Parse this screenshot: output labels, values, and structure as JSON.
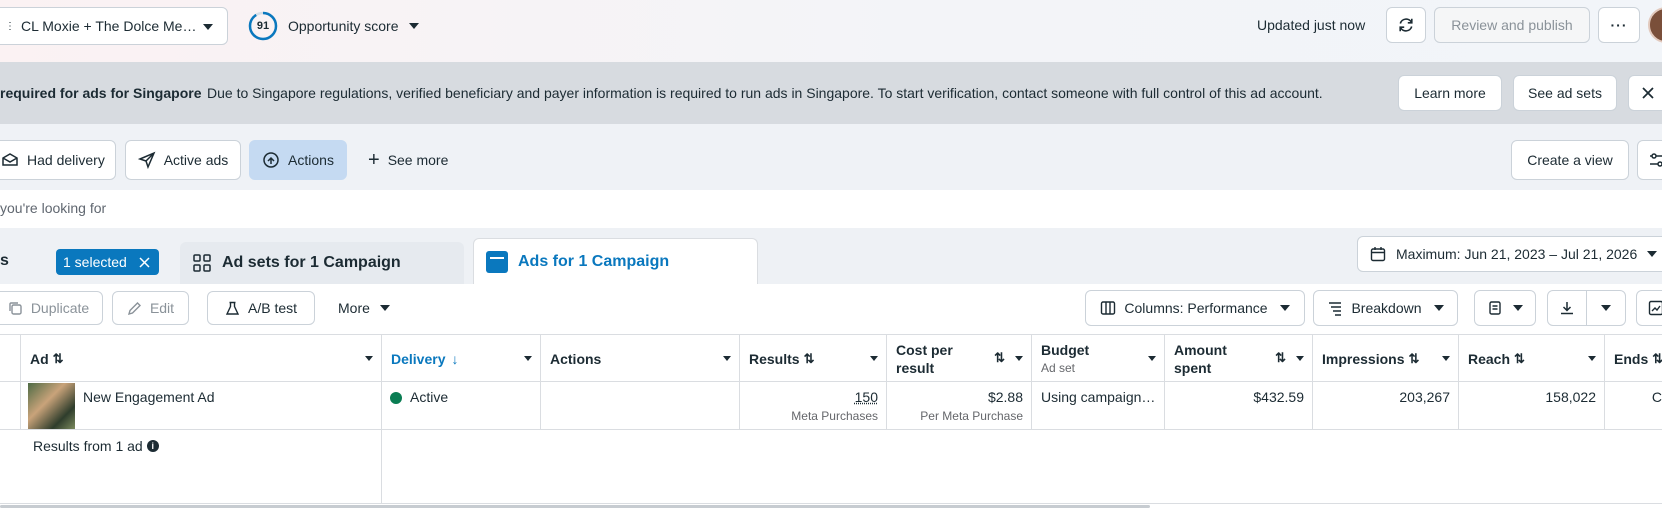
{
  "header": {
    "account_name": "CL Moxie + The Dolce Me…",
    "opportunity_score": "91",
    "opportunity_label": "Opportunity score",
    "updated_text": "Updated just now",
    "review_publish_label": "Review and publish"
  },
  "banner": {
    "title": "required for ads for Singapore",
    "message": "Due to Singapore regulations, verified beneficiary and payer information is required to run ads in Singapore. To start verification, contact someone with full control of this ad account.",
    "learn_more_label": "Learn more",
    "see_ad_sets_label": "See ad sets"
  },
  "filters": {
    "had_delivery": "Had delivery",
    "active_ads": "Active ads",
    "actions": "Actions",
    "see_more": "See more",
    "create_view": "Create a view"
  },
  "search": {
    "placeholder_fragment": "you're looking for"
  },
  "tabs": {
    "campaigns_fragment": "s",
    "selected_badge": "1 selected",
    "ad_sets": "Ad sets for 1 Campaign",
    "ads": "Ads for 1 Campaign",
    "date_range": "Maximum: Jun 21, 2023 – Jul 21, 2026"
  },
  "toolbar": {
    "duplicate": "Duplicate",
    "edit": "Edit",
    "ab_test": "A/B test",
    "more": "More",
    "columns": "Columns: Performance",
    "breakdown": "Breakdown"
  },
  "table": {
    "columns": {
      "ad": "Ad",
      "delivery": "Delivery",
      "actions": "Actions",
      "results": "Results",
      "cost_per_result_1": "Cost per",
      "cost_per_result_2": "result",
      "budget": "Budget",
      "budget_sub": "Ad set",
      "amount_spent_1": "Amount",
      "amount_spent_2": "spent",
      "impressions": "Impressions",
      "reach": "Reach",
      "ends": "Ends"
    },
    "row": {
      "ad_name": "New Engagement Ad",
      "delivery": "Active",
      "results": "150",
      "results_sub": "Meta Purchases",
      "cost_per_result": "$2.88",
      "cost_sub": "Per Meta Purchase",
      "budget": "Using campaign…",
      "amount_spent": "$432.59",
      "impressions": "203,267",
      "reach": "158,022",
      "ends": "C"
    },
    "footer": {
      "results_from": "Results from 1 ad"
    }
  },
  "colors": {
    "accent": "#0a78be",
    "active_green": "#0a7d53",
    "selected_badge_bg": "#0a78be",
    "actions_chip_bg": "#c5daf2"
  }
}
